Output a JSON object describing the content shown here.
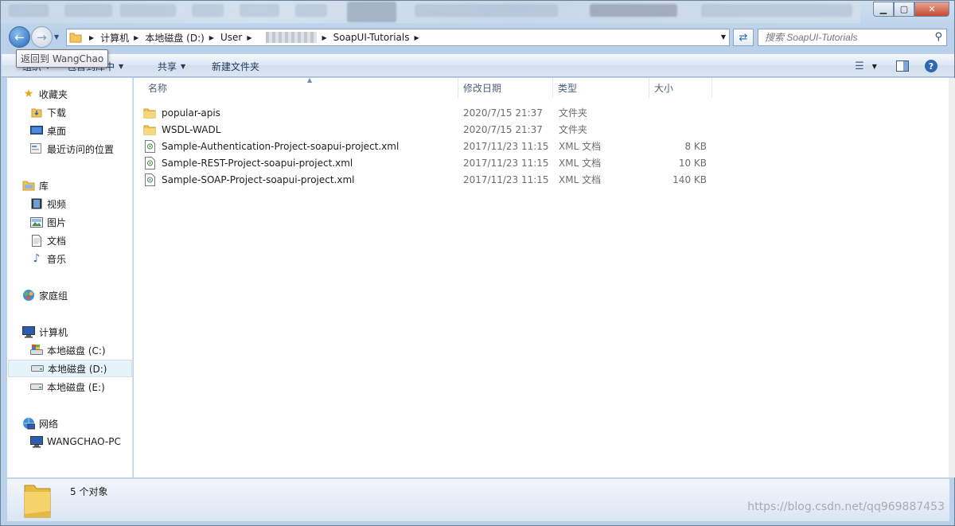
{
  "window": {
    "minimize": "▁",
    "maximize": "▢",
    "close": "✕"
  },
  "address": {
    "crumbs": [
      "计算机",
      "本地磁盘 (D:)",
      "User",
      "SoapUI-Tutorials"
    ],
    "search_placeholder": "搜索 SoapUI-Tutorials"
  },
  "tooltip": "返回到 WangChao",
  "toolbar": {
    "organize": "组织",
    "include": "包含到库中",
    "share": "共享",
    "new_folder": "新建文件夹"
  },
  "sidebar": {
    "favorites": {
      "label": "收藏夹",
      "items": [
        "下载",
        "桌面",
        "最近访问的位置"
      ]
    },
    "libraries": {
      "label": "库",
      "items": [
        "视频",
        "图片",
        "文档",
        "音乐"
      ]
    },
    "homegroup": "家庭组",
    "computer": {
      "label": "计算机",
      "items": [
        "本地磁盘 (C:)",
        "本地磁盘 (D:)",
        "本地磁盘 (E:)"
      ]
    },
    "network": {
      "label": "网络",
      "items": [
        "WANGCHAO-PC"
      ]
    }
  },
  "columns": {
    "name": "名称",
    "date": "修改日期",
    "type": "类型",
    "size": "大小"
  },
  "files": [
    {
      "name": "popular-apis",
      "date": "2020/7/15 21:37",
      "type": "文件夹",
      "size": "",
      "icon": "folder-icon"
    },
    {
      "name": "WSDL-WADL",
      "date": "2020/7/15 21:37",
      "type": "文件夹",
      "size": "",
      "icon": "folder-icon"
    },
    {
      "name": "Sample-Authentication-Project-soapui-project.xml",
      "date": "2017/11/23 11:15",
      "type": "XML 文档",
      "size": "8 KB",
      "icon": "xml-file-icon"
    },
    {
      "name": "Sample-REST-Project-soapui-project.xml",
      "date": "2017/11/23 11:15",
      "type": "XML 文档",
      "size": "10 KB",
      "icon": "xml-file-icon"
    },
    {
      "name": "Sample-SOAP-Project-soapui-project.xml",
      "date": "2017/11/23 11:15",
      "type": "XML 文档",
      "size": "140 KB",
      "icon": "xml-file-icon"
    }
  ],
  "status": {
    "count_text": "5 个对象"
  },
  "watermark": "https://blog.csdn.net/qq969887453"
}
